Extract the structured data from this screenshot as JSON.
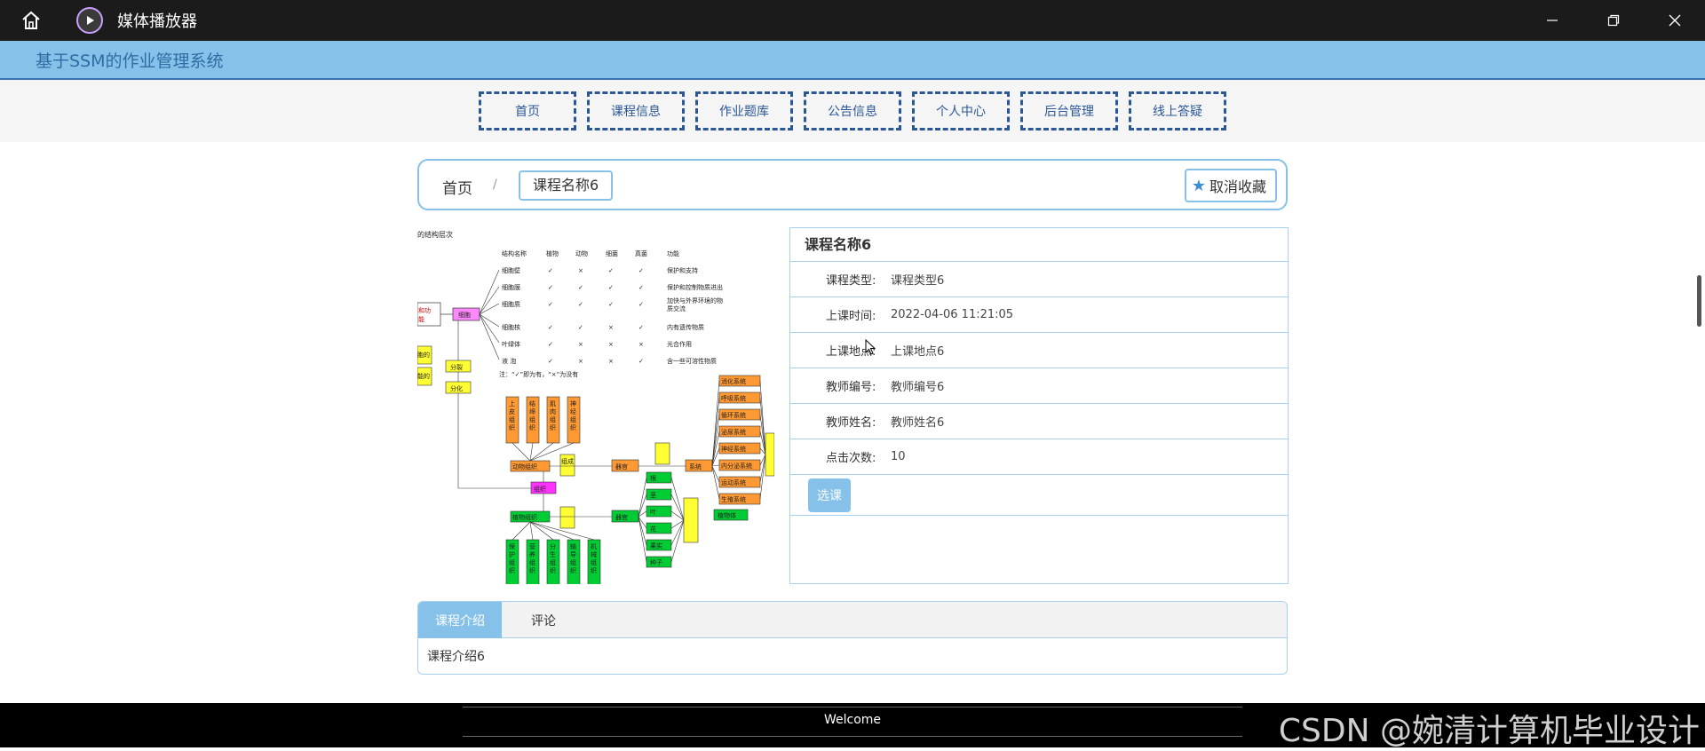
{
  "titlebar": {
    "app_title": "媒体播放器"
  },
  "site": {
    "title": "基于SSM的作业管理系统"
  },
  "nav": {
    "items": [
      "首页",
      "课程信息",
      "作业题库",
      "公告信息",
      "个人中心",
      "后台管理",
      "线上答疑"
    ]
  },
  "breadcrumb": {
    "home": "首页",
    "separator": "/",
    "current": "课程名称6"
  },
  "favorite_button": {
    "label": "取消收藏",
    "icon": "star-icon"
  },
  "diagram": {
    "heading": "的结构层次",
    "table_headers": [
      "结构名称",
      "植物",
      "动物",
      "细菌",
      "真菌",
      "功能"
    ],
    "rows": [
      {
        "name": "细胞壁",
        "marks": [
          "✓",
          "×",
          "✓",
          "✓"
        ],
        "func": "保护和支持"
      },
      {
        "name": "细胞膜",
        "marks": [
          "✓",
          "✓",
          "✓",
          "✓"
        ],
        "func": "保护和控制物质进出"
      },
      {
        "name": "细胞质",
        "marks": [
          "✓",
          "✓",
          "✓",
          "✓"
        ],
        "func": "加快与外界环境的物质交流"
      },
      {
        "name": "细胞核",
        "marks": [
          "✓",
          "✓",
          "×",
          "✓"
        ],
        "func": "内有遗传物质"
      },
      {
        "name": "叶绿体",
        "marks": [
          "✓",
          "×",
          "×",
          "×"
        ],
        "func": "光合作用"
      },
      {
        "name": "液  泡",
        "marks": [
          "✓",
          "×",
          "×",
          "✓"
        ],
        "func": "含一些可溶性物质"
      }
    ],
    "note": "注：“✓”即为有，“×”为没有",
    "labels": {
      "cell": "细胞",
      "division": "分裂",
      "differentiation": "分化",
      "animal_tissue": "动物组织",
      "plant_tissue": "植物组织",
      "tissue_box": "组织",
      "organ": "器官",
      "system": "系统",
      "compose": "组成",
      "organ2": "器官",
      "plant_body": "植物体",
      "animal_tissues": [
        "上皮组织",
        "结缔组织",
        "肌肉组织",
        "神经组织"
      ],
      "plant_tissues": [
        "保护组织",
        "营养组织",
        "分生组织",
        "输导组织",
        "机械组织"
      ],
      "plant_organs": [
        "根",
        "茎",
        "叶",
        "花",
        "果实",
        "种子"
      ],
      "systems": [
        "消化系统",
        "呼吸系统",
        "循环系统",
        "泌尿系统",
        "神经系统",
        "内分泌系统",
        "运动系统",
        "生殖系统"
      ],
      "left_labels": [
        "和功",
        "能",
        "胞的",
        "能的"
      ]
    }
  },
  "detail": {
    "title": "课程名称6",
    "fields": [
      {
        "label": "课程类型:",
        "value": "课程类型6"
      },
      {
        "label": "上课时间:",
        "value": "2022-04-06 11:21:05"
      },
      {
        "label": "上课地点:",
        "value": "上课地点6"
      },
      {
        "label": "教师编号:",
        "value": "教师编号6"
      },
      {
        "label": "教师姓名:",
        "value": "教师姓名6"
      },
      {
        "label": "点击次数:",
        "value": "10"
      }
    ],
    "select_button": "选课"
  },
  "tabs": {
    "items": [
      "课程介绍",
      "评论"
    ],
    "active": 0,
    "content": "课程介绍6"
  },
  "footer": {
    "text": "Welcome",
    "watermark": "CSDN @婉清计算机毕业设计"
  },
  "colors": {
    "header_bg": "#85c1e9",
    "nav_border": "#2b5797",
    "accent": "#85c1e9"
  }
}
